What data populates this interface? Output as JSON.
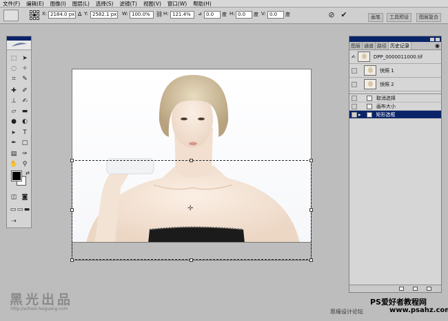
{
  "menubar": {
    "items": [
      "文件(F)",
      "编辑(E)",
      "图像(I)",
      "图层(L)",
      "选择(S)",
      "滤镜(T)",
      "视图(V)",
      "窗口(W)",
      "帮助(H)"
    ]
  },
  "options": {
    "x_label": "X:",
    "x_value": "2184.0 px",
    "y_label": "Y:",
    "y_value": "2582.1 px",
    "w_label": "W:",
    "w_value": "100.0%",
    "h_label": "H:",
    "h_value": "121.4%",
    "angle_value": "0.0",
    "angle_unit": "度",
    "hskew_label": "H:",
    "hskew_value": "0.0",
    "hskew_unit": "度",
    "vskew_label": "V:",
    "vskew_value": "0.0",
    "vskew_unit": "度",
    "cancel_icon": "cancel-icon",
    "commit_icon": "commit-icon",
    "well_tabs": [
      "画笔",
      "工具预设",
      "图层复合"
    ]
  },
  "history_panel": {
    "tabs": [
      "图层",
      "通道",
      "路径",
      "历史记录"
    ],
    "active_tab": 3,
    "snapshots": [
      {
        "label": "DPP_0000011000.tif"
      },
      {
        "label": "快照 1"
      },
      {
        "label": "快照 2"
      }
    ],
    "states": [
      {
        "label": "取消选择",
        "selected": false
      },
      {
        "label": "画布大小",
        "selected": false
      },
      {
        "label": "矩形选框",
        "selected": true
      }
    ],
    "selection_color": "#0a246a"
  },
  "watermarks": {
    "logo": "黑光出品",
    "logo_url": "http://school.heiguang.com",
    "ps_text": "PS爱好者教程网",
    "site_text": "思缘设计论坛",
    "url_text": "www.psahz.com"
  },
  "colors": {
    "foreground": "#000000",
    "background": "#ffffff",
    "workspace": "#bdbdbd"
  }
}
